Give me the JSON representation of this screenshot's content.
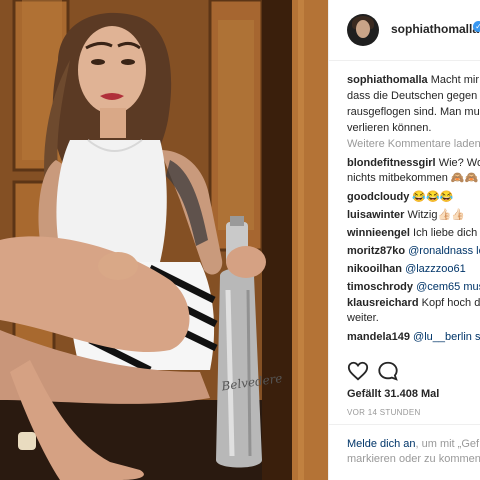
{
  "post": {
    "username": "sophiathomalla",
    "verified": true,
    "caption_lines": [
      "Macht mir",
      "dass die Deutschen gegen",
      "rausgeflogen sind. Man mu",
      "verlieren können."
    ],
    "load_more": "Weitere Kommentare laden",
    "comments": [
      {
        "user": "blondefitnessgirl",
        "lines": [
          "Wie? Wo",
          "nichts mitbekommen 🙈🙈"
        ]
      },
      {
        "user": "goodcloudy",
        "lines": [
          "😂😂😂"
        ]
      },
      {
        "user": "luisawinter",
        "lines": [
          "Witzig👍🏻👍🏻"
        ]
      },
      {
        "user": "winnieengel",
        "lines": [
          "Ich liebe dich"
        ]
      },
      {
        "user": "moritz87ko",
        "lines": [
          "@ronaldnass lo"
        ]
      },
      {
        "user": "nikooilhan",
        "lines": [
          "@lazzzoo61"
        ]
      },
      {
        "user": "timoschrody",
        "lines": [
          "@cem65 mus"
        ]
      },
      {
        "user": "klausreichard",
        "lines": [
          "Kopf hoch da",
          "weiter."
        ]
      },
      {
        "user": "mandela149",
        "lines": [
          "@lu__berlin sh"
        ]
      }
    ],
    "likes": "Gefällt 31.408 Mal",
    "timestamp": "VOR 14 STUNDEN",
    "login_link": "Melde dich an",
    "login_rest": ", um mit „Gef",
    "login_line2": "markieren oder zu kommen"
  },
  "photo": {
    "bottle_text": "Belvedere"
  },
  "colors": {
    "link": "#003569",
    "muted": "#999999",
    "text": "#262626",
    "verified": "#3897f0"
  },
  "icons": [
    "heart-icon",
    "comment-icon",
    "verified-badge-icon"
  ]
}
